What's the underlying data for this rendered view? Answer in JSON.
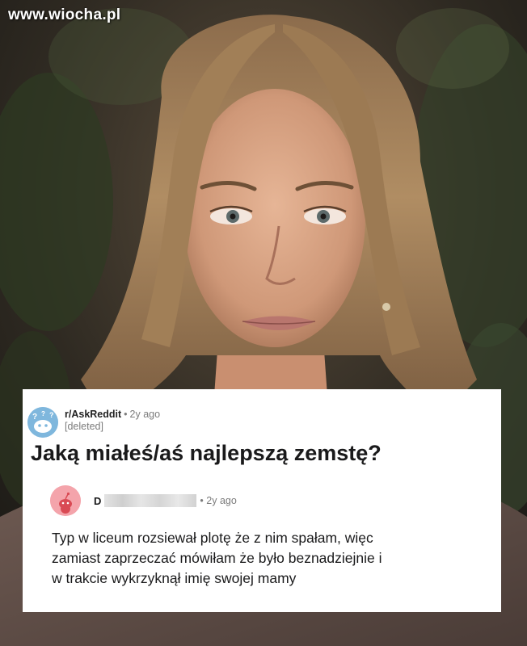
{
  "watermark": {
    "text": "www.wiocha.pl"
  },
  "post": {
    "subreddit": "r/AskReddit",
    "separator": "•",
    "age": "2y ago",
    "author": "[deleted]",
    "title": "Jaką miałeś/aś najlepszą zemstę?"
  },
  "comment": {
    "author_initial": "D",
    "separator": "•",
    "age": "2y ago",
    "body_lines": [
      "Typ w liceum rozsiewał plotę że z nim spałam, więc",
      "zamiast zaprzeczać mówiłam że było beznadziejnie i",
      "w trakcie wykrzyknął imię swojej mamy"
    ]
  },
  "colors": {
    "card_background": "#ffffff",
    "subreddit_avatar": "#7fb7dd",
    "user_avatar": "#f4a4ab",
    "muted_text": "#7c7c7c",
    "primary_text": "#1a1a1b"
  },
  "icons": {
    "subreddit_avatar": "snoo-with-question-marks-icon",
    "user_avatar": "snoo-avatar-icon"
  }
}
